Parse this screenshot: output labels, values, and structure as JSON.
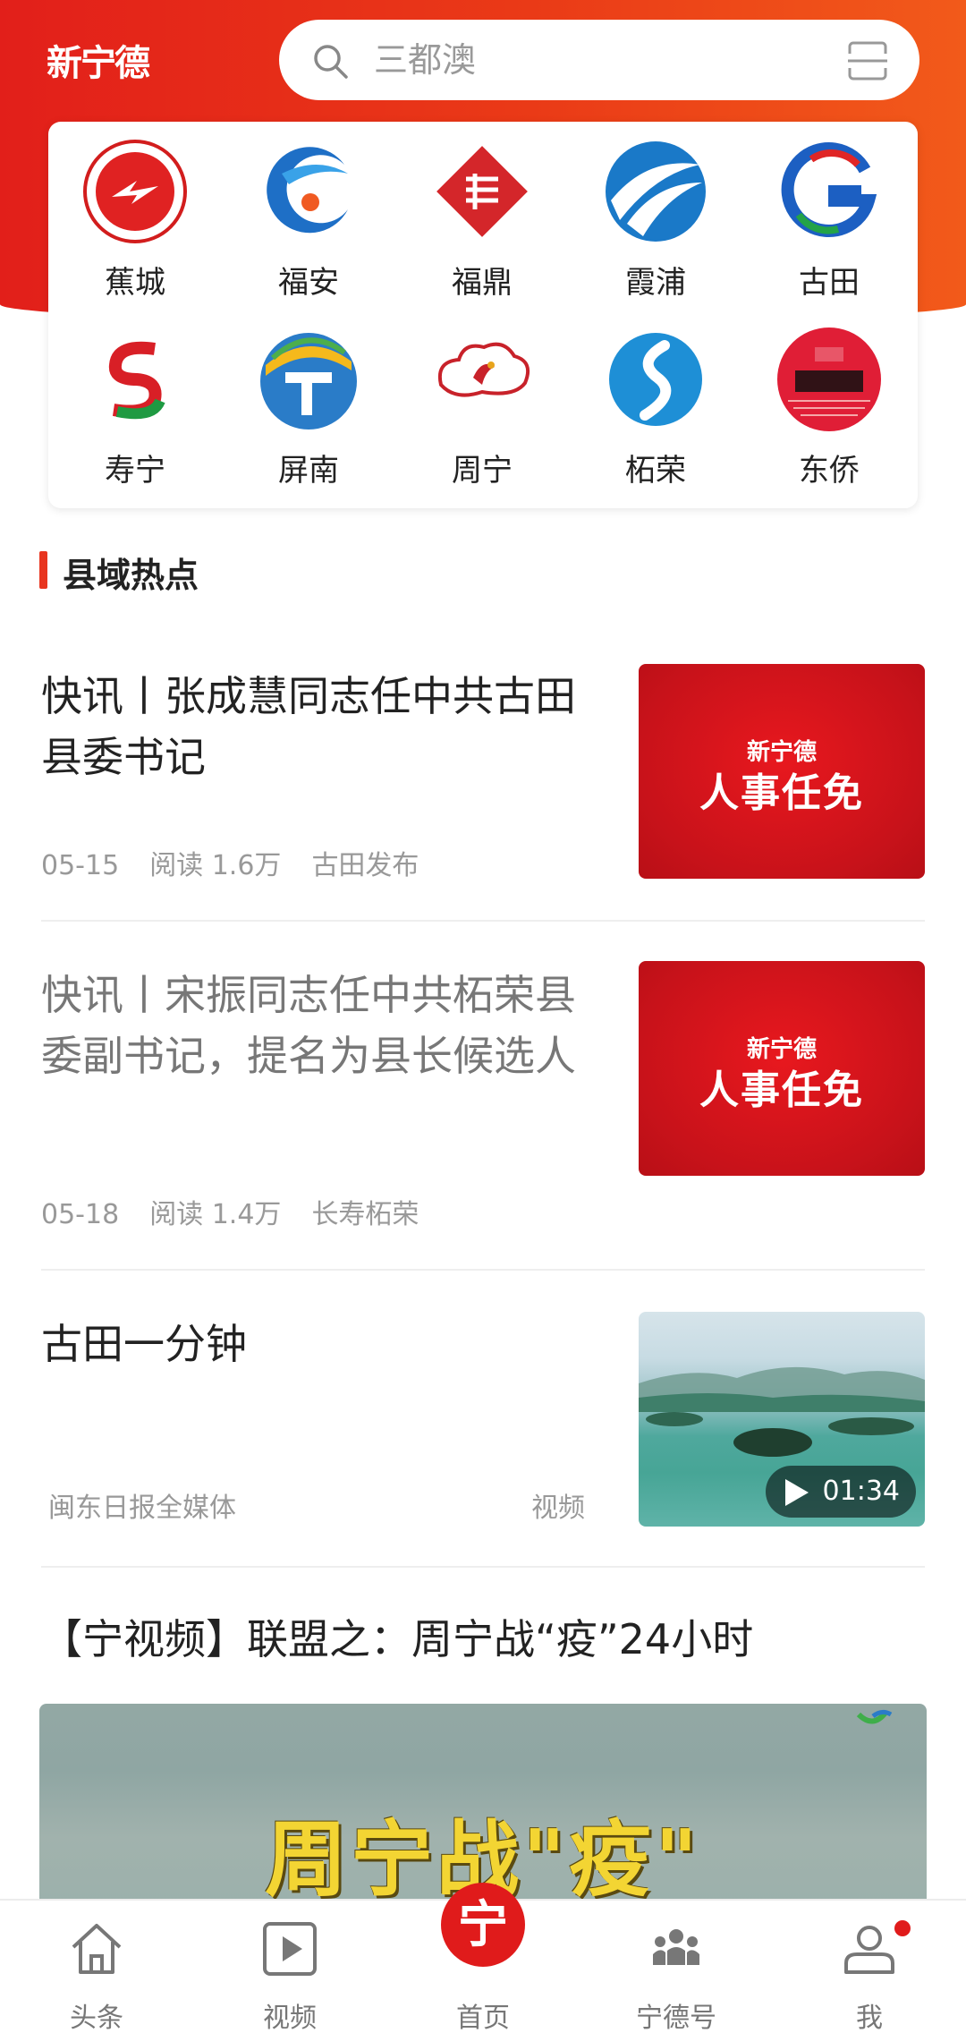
{
  "header": {
    "logo": "新宁德",
    "search_placeholder": "三都澳"
  },
  "portals": [
    {
      "label": "蕉城",
      "icon": "jiaocheng-logo-icon"
    },
    {
      "label": "福安",
      "icon": "fuan-logo-icon"
    },
    {
      "label": "福鼎",
      "icon": "fuding-logo-icon"
    },
    {
      "label": "霞浦",
      "icon": "xiapu-logo-icon"
    },
    {
      "label": "古田",
      "icon": "gutian-logo-icon"
    },
    {
      "label": "寿宁",
      "icon": "shouning-logo-icon"
    },
    {
      "label": "屏南",
      "icon": "pingnan-logo-icon"
    },
    {
      "label": "周宁",
      "icon": "zhouning-logo-icon"
    },
    {
      "label": "柘荣",
      "icon": "zherong-logo-icon"
    },
    {
      "label": "东侨",
      "icon": "dongqiao-logo-icon"
    }
  ],
  "section": {
    "title": "县域热点"
  },
  "articles": [
    {
      "title": "快讯丨张成慧同志任中共古田县委书记",
      "date": "05-15",
      "reads": "阅读 1.6万",
      "source": "古田发布",
      "thumb_small": "新宁德",
      "thumb_big": "人事任免"
    },
    {
      "title": "快讯丨宋振同志任中共柘荣县委副书记，提名为县长候选人",
      "date": "05-18",
      "reads": "阅读 1.4万",
      "source": "长寿柘荣",
      "thumb_small": "新宁德",
      "thumb_big": "人事任免"
    },
    {
      "title": "古田一分钟",
      "source": "闽东日报全媒体",
      "type": "视频",
      "duration": "01:34"
    },
    {
      "title": "【宁视频】联盟之：周宁战“疫”24小时",
      "video_caption": "周宁战\"疫\""
    }
  ],
  "tabbar": {
    "tabs": [
      {
        "label": "头条",
        "icon": "home-outline-icon"
      },
      {
        "label": "视频",
        "icon": "video-play-icon"
      },
      {
        "label": "首页",
        "icon": "ning-home-icon",
        "glyph": "宁"
      },
      {
        "label": "宁德号",
        "icon": "group-people-icon"
      },
      {
        "label": "我",
        "icon": "user-profile-icon"
      }
    ]
  },
  "colors": {
    "brand_red": "#e21f1a",
    "accent_orange": "#f25a1a"
  }
}
